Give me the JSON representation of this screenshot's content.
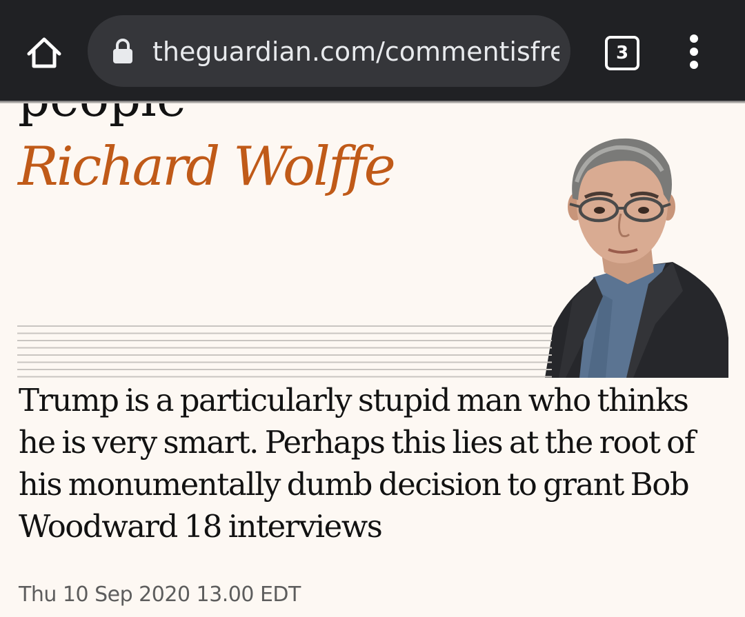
{
  "browser": {
    "url": "theguardian.com/commentisfre",
    "tab_count": "3",
    "icons": [
      "home-icon",
      "lock-icon",
      "tab-switcher-icon",
      "overflow-menu-icon"
    ],
    "toolbar_color": "#202124",
    "url_bar_color": "#35363a"
  },
  "article": {
    "headline_tail": "people",
    "byline": "Richard Wolffe",
    "byline_color": "#c05a18",
    "standfirst": "Trump is a particularly stupid man who thinks he is very smart. Perhaps this lies at the root of his monumentally dumb decision to grant Bob Woodward 18 interviews",
    "dateline": "Thu 10 Sep 2020 13.00 EDT",
    "background_color": "#fdf8f3"
  }
}
